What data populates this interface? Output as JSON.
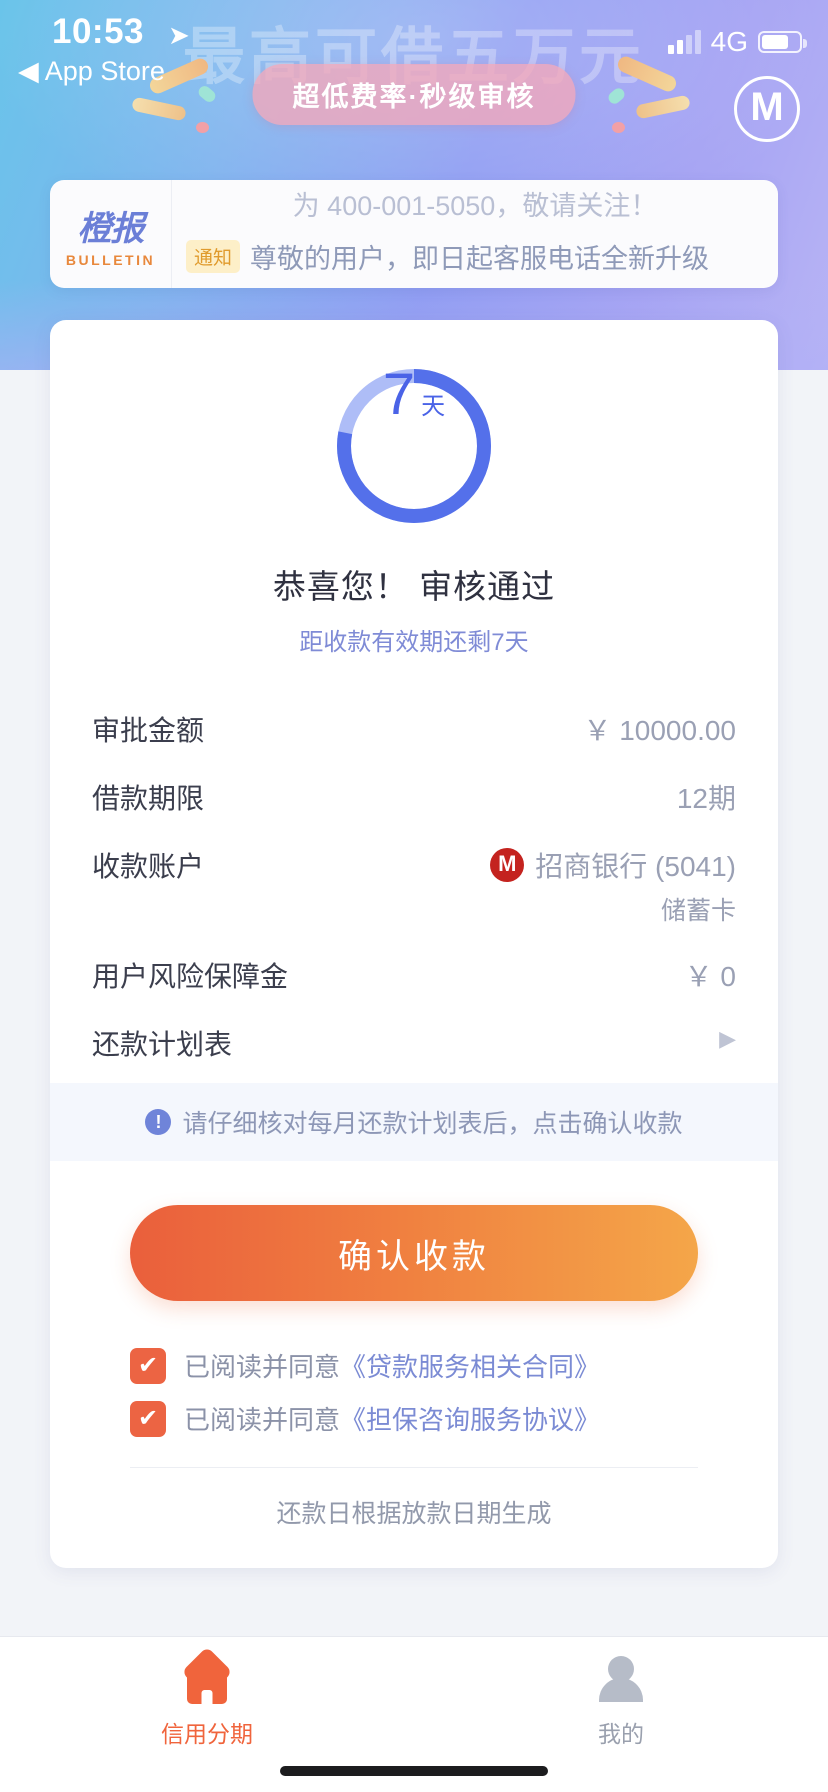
{
  "status_bar": {
    "time": "10:53",
    "location_icon": "location-arrow-icon",
    "back_label": "◀ App Store",
    "network": "4G",
    "signal_icon": "signal-bars-icon",
    "battery_icon": "battery-icon"
  },
  "hero": {
    "background_title": "最高可借五万元",
    "pill_label": "超低费率·秒级审核",
    "brand_mark": "M",
    "gradient_from": "#69c4ea",
    "gradient_to": "#b8b4f5"
  },
  "bulletin": {
    "logo_cn": "橙报",
    "logo_en": "BULLETIN",
    "line1": "为 400-001-5050，敬请关注！",
    "badge": "通知",
    "line2": "尊敬的用户，即日起客服电话全新升级"
  },
  "approval": {
    "ring": {
      "days": "7",
      "unit": "天",
      "percent": 78,
      "track_color": "#aebdf7",
      "progress_color": "#5470ea"
    },
    "title": "恭喜您！ 审核通过",
    "subtitle": "距收款有效期还剩7天",
    "rows": [
      {
        "label": "审批金额",
        "value": "￥ 10000.00",
        "type": "text"
      },
      {
        "label": "借款期限",
        "value": "12期",
        "type": "text"
      },
      {
        "label": "收款账户",
        "value": "招商银行 (5041)",
        "sub": "储蓄卡",
        "bank_icon": "cmb-bank-icon",
        "bank_mark": "M",
        "type": "bank"
      },
      {
        "label": "用户风险保障金",
        "value": "￥ 0",
        "type": "text"
      },
      {
        "label": "还款计划表",
        "value": "▶",
        "type": "link"
      }
    ]
  },
  "tip": {
    "icon": "exclamation-icon",
    "icon_glyph": "!",
    "text": "请仔细核对每月还款计划表后，点击确认收款"
  },
  "cta": {
    "label": "确认收款",
    "gradient_from": "#ea5f3c",
    "gradient_to": "#f4a649"
  },
  "agreements": [
    {
      "checked": true,
      "prefix": "已阅读并同意",
      "link": "《贷款服务相关合同》",
      "check_glyph": "✔"
    },
    {
      "checked": true,
      "prefix": "已阅读并同意",
      "link": "《担保咨询服务协议》",
      "check_glyph": "✔"
    }
  ],
  "footer_note": "还款日根据放款日期生成",
  "tabbar": {
    "items": [
      {
        "label": "信用分期",
        "icon": "home-icon",
        "active": true,
        "color": "#f0643c"
      },
      {
        "label": "我的",
        "icon": "user-icon",
        "active": false,
        "color": "#9aa0ae"
      }
    ]
  }
}
